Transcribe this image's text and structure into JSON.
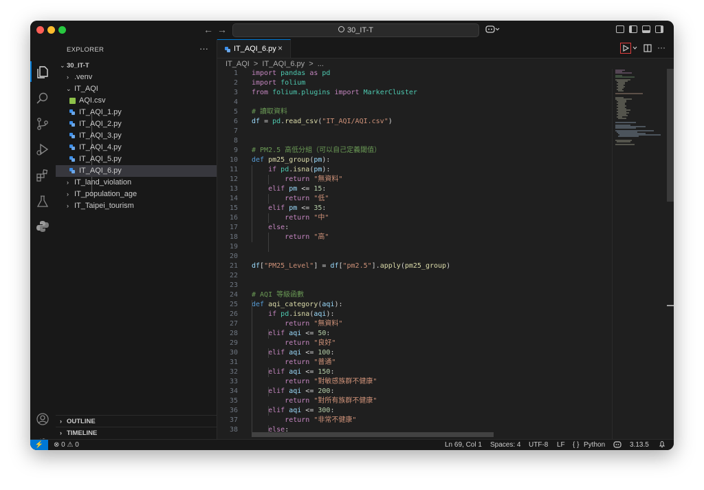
{
  "window": {
    "search_text": "30_IT-T",
    "nav_back": "←",
    "nav_forward": "→"
  },
  "explorer": {
    "title": "EXPLORER",
    "more": "···",
    "root": "30_IT-T",
    "items": [
      {
        "label": ".venv",
        "kind": "folder-collapsed"
      },
      {
        "label": "IT_AQI",
        "kind": "folder-open"
      },
      {
        "label": "AQI.csv",
        "kind": "csv"
      },
      {
        "label": "IT_AQI_1.py",
        "kind": "py"
      },
      {
        "label": "IT_AQI_2.py",
        "kind": "py"
      },
      {
        "label": "IT_AQI_3.py",
        "kind": "py"
      },
      {
        "label": "IT_AQI_4.py",
        "kind": "py"
      },
      {
        "label": "IT_AQI_5.py",
        "kind": "py"
      },
      {
        "label": "IT_AQI_6.py",
        "kind": "py",
        "selected": true
      },
      {
        "label": "IT_land_violation",
        "kind": "folder-collapsed"
      },
      {
        "label": "IT_population_age",
        "kind": "folder-collapsed"
      },
      {
        "label": "IT_Taipei_tourism",
        "kind": "folder-collapsed"
      }
    ],
    "outline": "OUTLINE",
    "timeline": "TIMELINE"
  },
  "editor": {
    "tab_label": "IT_AQI_6.py",
    "tab_close": "×",
    "breadcrumb": [
      "IT_AQI",
      ">",
      "IT_AQI_6.py",
      ">",
      "..."
    ],
    "lines": [
      {
        "n": "1",
        "tokens": [
          [
            "kw",
            "import"
          ],
          [
            "op",
            " "
          ],
          [
            "mod",
            "pandas"
          ],
          [
            "op",
            " "
          ],
          [
            "kw",
            "as"
          ],
          [
            "op",
            " "
          ],
          [
            "mod",
            "pd"
          ]
        ]
      },
      {
        "n": "2",
        "tokens": [
          [
            "kw",
            "import"
          ],
          [
            "op",
            " "
          ],
          [
            "mod",
            "folium"
          ]
        ]
      },
      {
        "n": "3",
        "tokens": [
          [
            "kw",
            "from"
          ],
          [
            "op",
            " "
          ],
          [
            "mod",
            "folium.plugins"
          ],
          [
            "op",
            " "
          ],
          [
            "kw",
            "import"
          ],
          [
            "op",
            " "
          ],
          [
            "mod",
            "MarkerCluster"
          ]
        ]
      },
      {
        "n": "4",
        "tokens": []
      },
      {
        "n": "5",
        "tokens": [
          [
            "cmt",
            "# 讀取資料"
          ]
        ]
      },
      {
        "n": "6",
        "tokens": [
          [
            "var",
            "df"
          ],
          [
            "op",
            " = "
          ],
          [
            "mod",
            "pd"
          ],
          [
            "op",
            "."
          ],
          [
            "fn",
            "read_csv"
          ],
          [
            "op",
            "("
          ],
          [
            "str",
            "\"IT_AQI/AQI.csv\""
          ],
          [
            "op",
            ")"
          ]
        ]
      },
      {
        "n": "7",
        "tokens": []
      },
      {
        "n": "8",
        "tokens": []
      },
      {
        "n": "9",
        "tokens": [
          [
            "cmt",
            "# PM2.5 高低分組（可以自己定義閾值）"
          ]
        ]
      },
      {
        "n": "10",
        "tokens": [
          [
            "kw2",
            "def"
          ],
          [
            "op",
            " "
          ],
          [
            "fn",
            "pm25_group"
          ],
          [
            "op",
            "("
          ],
          [
            "var",
            "pm"
          ],
          [
            "op",
            "):"
          ]
        ]
      },
      {
        "n": "11",
        "tokens": [
          [
            "op",
            "    "
          ],
          [
            "kw",
            "if"
          ],
          [
            "op",
            " "
          ],
          [
            "mod",
            "pd"
          ],
          [
            "op",
            "."
          ],
          [
            "fn",
            "isna"
          ],
          [
            "op",
            "("
          ],
          [
            "var",
            "pm"
          ],
          [
            "op",
            "):"
          ]
        ]
      },
      {
        "n": "12",
        "tokens": [
          [
            "op",
            "        "
          ],
          [
            "kw",
            "return"
          ],
          [
            "op",
            " "
          ],
          [
            "str",
            "\"無資料\""
          ]
        ]
      },
      {
        "n": "13",
        "tokens": [
          [
            "op",
            "    "
          ],
          [
            "kw",
            "elif"
          ],
          [
            "op",
            " "
          ],
          [
            "var",
            "pm"
          ],
          [
            "op",
            " <= "
          ],
          [
            "num",
            "15"
          ],
          [
            "op",
            ":"
          ]
        ]
      },
      {
        "n": "14",
        "tokens": [
          [
            "op",
            "        "
          ],
          [
            "kw",
            "return"
          ],
          [
            "op",
            " "
          ],
          [
            "str",
            "\"低\""
          ]
        ]
      },
      {
        "n": "15",
        "tokens": [
          [
            "op",
            "    "
          ],
          [
            "kw",
            "elif"
          ],
          [
            "op",
            " "
          ],
          [
            "var",
            "pm"
          ],
          [
            "op",
            " <= "
          ],
          [
            "num",
            "35"
          ],
          [
            "op",
            ":"
          ]
        ]
      },
      {
        "n": "16",
        "tokens": [
          [
            "op",
            "        "
          ],
          [
            "kw",
            "return"
          ],
          [
            "op",
            " "
          ],
          [
            "str",
            "\"中\""
          ]
        ]
      },
      {
        "n": "17",
        "tokens": [
          [
            "op",
            "    "
          ],
          [
            "kw",
            "else"
          ],
          [
            "op",
            ":"
          ]
        ]
      },
      {
        "n": "18",
        "tokens": [
          [
            "op",
            "        "
          ],
          [
            "kw",
            "return"
          ],
          [
            "op",
            " "
          ],
          [
            "str",
            "\"高\""
          ]
        ]
      },
      {
        "n": "19",
        "tokens": []
      },
      {
        "n": "20",
        "tokens": []
      },
      {
        "n": "21",
        "tokens": [
          [
            "var",
            "df"
          ],
          [
            "op",
            "["
          ],
          [
            "str",
            "\"PM25_Level\""
          ],
          [
            "op",
            "] = "
          ],
          [
            "var",
            "df"
          ],
          [
            "op",
            "["
          ],
          [
            "str",
            "\"pm2.5\""
          ],
          [
            "op",
            "]."
          ],
          [
            "fn",
            "apply"
          ],
          [
            "op",
            "("
          ],
          [
            "fn",
            "pm25_group"
          ],
          [
            "op",
            ")"
          ]
        ]
      },
      {
        "n": "22",
        "tokens": []
      },
      {
        "n": "23",
        "tokens": []
      },
      {
        "n": "24",
        "tokens": [
          [
            "cmt",
            "# AQI 等級函數"
          ]
        ]
      },
      {
        "n": "25",
        "tokens": [
          [
            "kw2",
            "def"
          ],
          [
            "op",
            " "
          ],
          [
            "fn",
            "aqi_category"
          ],
          [
            "op",
            "("
          ],
          [
            "var",
            "aqi"
          ],
          [
            "op",
            "):"
          ]
        ]
      },
      {
        "n": "26",
        "tokens": [
          [
            "op",
            "    "
          ],
          [
            "kw",
            "if"
          ],
          [
            "op",
            " "
          ],
          [
            "mod",
            "pd"
          ],
          [
            "op",
            "."
          ],
          [
            "fn",
            "isna"
          ],
          [
            "op",
            "("
          ],
          [
            "var",
            "aqi"
          ],
          [
            "op",
            "):"
          ]
        ]
      },
      {
        "n": "27",
        "tokens": [
          [
            "op",
            "        "
          ],
          [
            "kw",
            "return"
          ],
          [
            "op",
            " "
          ],
          [
            "str",
            "\"無資料\""
          ]
        ]
      },
      {
        "n": "28",
        "tokens": [
          [
            "op",
            "    "
          ],
          [
            "kw",
            "elif"
          ],
          [
            "op",
            " "
          ],
          [
            "var",
            "aqi"
          ],
          [
            "op",
            " <= "
          ],
          [
            "num",
            "50"
          ],
          [
            "op",
            ":"
          ]
        ]
      },
      {
        "n": "29",
        "tokens": [
          [
            "op",
            "        "
          ],
          [
            "kw",
            "return"
          ],
          [
            "op",
            " "
          ],
          [
            "str",
            "\"良好\""
          ]
        ]
      },
      {
        "n": "30",
        "tokens": [
          [
            "op",
            "    "
          ],
          [
            "kw",
            "elif"
          ],
          [
            "op",
            " "
          ],
          [
            "var",
            "aqi"
          ],
          [
            "op",
            " <= "
          ],
          [
            "num",
            "100"
          ],
          [
            "op",
            ":"
          ]
        ]
      },
      {
        "n": "31",
        "tokens": [
          [
            "op",
            "        "
          ],
          [
            "kw",
            "return"
          ],
          [
            "op",
            " "
          ],
          [
            "str",
            "\"普通\""
          ]
        ]
      },
      {
        "n": "32",
        "tokens": [
          [
            "op",
            "    "
          ],
          [
            "kw",
            "elif"
          ],
          [
            "op",
            " "
          ],
          [
            "var",
            "aqi"
          ],
          [
            "op",
            " <= "
          ],
          [
            "num",
            "150"
          ],
          [
            "op",
            ":"
          ]
        ]
      },
      {
        "n": "33",
        "tokens": [
          [
            "op",
            "        "
          ],
          [
            "kw",
            "return"
          ],
          [
            "op",
            " "
          ],
          [
            "str",
            "\"對敏感族群不健康\""
          ]
        ]
      },
      {
        "n": "34",
        "tokens": [
          [
            "op",
            "    "
          ],
          [
            "kw",
            "elif"
          ],
          [
            "op",
            " "
          ],
          [
            "var",
            "aqi"
          ],
          [
            "op",
            " <= "
          ],
          [
            "num",
            "200"
          ],
          [
            "op",
            ":"
          ]
        ]
      },
      {
        "n": "35",
        "tokens": [
          [
            "op",
            "        "
          ],
          [
            "kw",
            "return"
          ],
          [
            "op",
            " "
          ],
          [
            "str",
            "\"對所有族群不健康\""
          ]
        ]
      },
      {
        "n": "36",
        "tokens": [
          [
            "op",
            "    "
          ],
          [
            "kw",
            "elif"
          ],
          [
            "op",
            " "
          ],
          [
            "var",
            "aqi"
          ],
          [
            "op",
            " <= "
          ],
          [
            "num",
            "300"
          ],
          [
            "op",
            ":"
          ]
        ]
      },
      {
        "n": "37",
        "tokens": [
          [
            "op",
            "        "
          ],
          [
            "kw",
            "return"
          ],
          [
            "op",
            " "
          ],
          [
            "str",
            "\"非常不健康\""
          ]
        ]
      },
      {
        "n": "38",
        "tokens": [
          [
            "op",
            "    "
          ],
          [
            "kw",
            "else"
          ],
          [
            "op",
            ":"
          ]
        ]
      }
    ]
  },
  "statusbar": {
    "errors": "0",
    "warnings": "0",
    "position": "Ln 69, Col 1",
    "spaces": "Spaces: 4",
    "encoding": "UTF-8",
    "eol": "LF",
    "language": "Python",
    "braces": "{ }",
    "python_version": "3.13.5"
  },
  "colors": {
    "accent": "#0078d4",
    "run_border": "#e03e3e"
  }
}
